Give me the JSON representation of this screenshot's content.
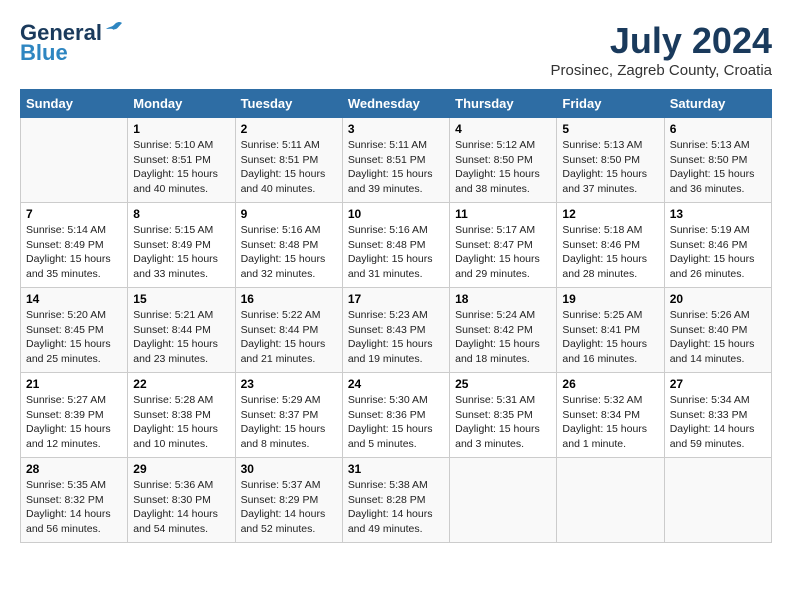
{
  "header": {
    "logo_general": "General",
    "logo_blue": "Blue",
    "month_title": "July 2024",
    "location": "Prosinec, Zagreb County, Croatia"
  },
  "days_of_week": [
    "Sunday",
    "Monday",
    "Tuesday",
    "Wednesday",
    "Thursday",
    "Friday",
    "Saturday"
  ],
  "weeks": [
    [
      {
        "day": "",
        "info": ""
      },
      {
        "day": "1",
        "info": "Sunrise: 5:10 AM\nSunset: 8:51 PM\nDaylight: 15 hours\nand 40 minutes."
      },
      {
        "day": "2",
        "info": "Sunrise: 5:11 AM\nSunset: 8:51 PM\nDaylight: 15 hours\nand 40 minutes."
      },
      {
        "day": "3",
        "info": "Sunrise: 5:11 AM\nSunset: 8:51 PM\nDaylight: 15 hours\nand 39 minutes."
      },
      {
        "day": "4",
        "info": "Sunrise: 5:12 AM\nSunset: 8:50 PM\nDaylight: 15 hours\nand 38 minutes."
      },
      {
        "day": "5",
        "info": "Sunrise: 5:13 AM\nSunset: 8:50 PM\nDaylight: 15 hours\nand 37 minutes."
      },
      {
        "day": "6",
        "info": "Sunrise: 5:13 AM\nSunset: 8:50 PM\nDaylight: 15 hours\nand 36 minutes."
      }
    ],
    [
      {
        "day": "7",
        "info": "Sunrise: 5:14 AM\nSunset: 8:49 PM\nDaylight: 15 hours\nand 35 minutes."
      },
      {
        "day": "8",
        "info": "Sunrise: 5:15 AM\nSunset: 8:49 PM\nDaylight: 15 hours\nand 33 minutes."
      },
      {
        "day": "9",
        "info": "Sunrise: 5:16 AM\nSunset: 8:48 PM\nDaylight: 15 hours\nand 32 minutes."
      },
      {
        "day": "10",
        "info": "Sunrise: 5:16 AM\nSunset: 8:48 PM\nDaylight: 15 hours\nand 31 minutes."
      },
      {
        "day": "11",
        "info": "Sunrise: 5:17 AM\nSunset: 8:47 PM\nDaylight: 15 hours\nand 29 minutes."
      },
      {
        "day": "12",
        "info": "Sunrise: 5:18 AM\nSunset: 8:46 PM\nDaylight: 15 hours\nand 28 minutes."
      },
      {
        "day": "13",
        "info": "Sunrise: 5:19 AM\nSunset: 8:46 PM\nDaylight: 15 hours\nand 26 minutes."
      }
    ],
    [
      {
        "day": "14",
        "info": "Sunrise: 5:20 AM\nSunset: 8:45 PM\nDaylight: 15 hours\nand 25 minutes."
      },
      {
        "day": "15",
        "info": "Sunrise: 5:21 AM\nSunset: 8:44 PM\nDaylight: 15 hours\nand 23 minutes."
      },
      {
        "day": "16",
        "info": "Sunrise: 5:22 AM\nSunset: 8:44 PM\nDaylight: 15 hours\nand 21 minutes."
      },
      {
        "day": "17",
        "info": "Sunrise: 5:23 AM\nSunset: 8:43 PM\nDaylight: 15 hours\nand 19 minutes."
      },
      {
        "day": "18",
        "info": "Sunrise: 5:24 AM\nSunset: 8:42 PM\nDaylight: 15 hours\nand 18 minutes."
      },
      {
        "day": "19",
        "info": "Sunrise: 5:25 AM\nSunset: 8:41 PM\nDaylight: 15 hours\nand 16 minutes."
      },
      {
        "day": "20",
        "info": "Sunrise: 5:26 AM\nSunset: 8:40 PM\nDaylight: 15 hours\nand 14 minutes."
      }
    ],
    [
      {
        "day": "21",
        "info": "Sunrise: 5:27 AM\nSunset: 8:39 PM\nDaylight: 15 hours\nand 12 minutes."
      },
      {
        "day": "22",
        "info": "Sunrise: 5:28 AM\nSunset: 8:38 PM\nDaylight: 15 hours\nand 10 minutes."
      },
      {
        "day": "23",
        "info": "Sunrise: 5:29 AM\nSunset: 8:37 PM\nDaylight: 15 hours\nand 8 minutes."
      },
      {
        "day": "24",
        "info": "Sunrise: 5:30 AM\nSunset: 8:36 PM\nDaylight: 15 hours\nand 5 minutes."
      },
      {
        "day": "25",
        "info": "Sunrise: 5:31 AM\nSunset: 8:35 PM\nDaylight: 15 hours\nand 3 minutes."
      },
      {
        "day": "26",
        "info": "Sunrise: 5:32 AM\nSunset: 8:34 PM\nDaylight: 15 hours\nand 1 minute."
      },
      {
        "day": "27",
        "info": "Sunrise: 5:34 AM\nSunset: 8:33 PM\nDaylight: 14 hours\nand 59 minutes."
      }
    ],
    [
      {
        "day": "28",
        "info": "Sunrise: 5:35 AM\nSunset: 8:32 PM\nDaylight: 14 hours\nand 56 minutes."
      },
      {
        "day": "29",
        "info": "Sunrise: 5:36 AM\nSunset: 8:30 PM\nDaylight: 14 hours\nand 54 minutes."
      },
      {
        "day": "30",
        "info": "Sunrise: 5:37 AM\nSunset: 8:29 PM\nDaylight: 14 hours\nand 52 minutes."
      },
      {
        "day": "31",
        "info": "Sunrise: 5:38 AM\nSunset: 8:28 PM\nDaylight: 14 hours\nand 49 minutes."
      },
      {
        "day": "",
        "info": ""
      },
      {
        "day": "",
        "info": ""
      },
      {
        "day": "",
        "info": ""
      }
    ]
  ]
}
